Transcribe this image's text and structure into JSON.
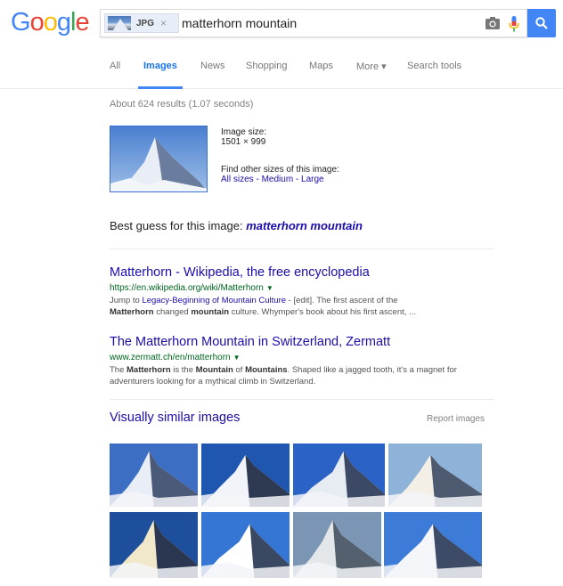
{
  "header": {
    "logo_letters": [
      "G",
      "o",
      "o",
      "g",
      "l",
      "e"
    ],
    "logo_colors": [
      "#4285f4",
      "#ea4335",
      "#fbbc05",
      "#4285f4",
      "#34a853",
      "#ea4335"
    ],
    "chip_label": "JPG",
    "chip_close": "×",
    "query": "matterhorn mountain"
  },
  "tabs": [
    {
      "label": "All",
      "active": false
    },
    {
      "label": "Images",
      "active": true
    },
    {
      "label": "News",
      "active": false
    },
    {
      "label": "Shopping",
      "active": false
    },
    {
      "label": "Maps",
      "active": false
    },
    {
      "label": "More ▾",
      "active": false
    },
    {
      "label": "Search tools",
      "active": false
    }
  ],
  "stats": "About 624 results (1.07 seconds)",
  "image_info": {
    "size_label": "Image size:",
    "size_value": "1501 × 999",
    "find_label": "Find other sizes of this image:",
    "sizes": [
      "All sizes",
      "Medium",
      "Large"
    ],
    "sep": " - "
  },
  "best_guess": {
    "label": "Best guess for this image: ",
    "value": "matterhorn mountain"
  },
  "results": [
    {
      "title": "Matterhorn - Wikipedia, the free encyclopedia",
      "url": "https://en.wikipedia.org/wiki/Matterhorn",
      "snippet_a": "Jump to ",
      "snippet_link": "Legacy-Beginning of Mountain Culture",
      "snippet_b": " - [edit]. The first ascent of the ",
      "snippet_bold1": "Matterhorn",
      "snippet_c": " changed ",
      "snippet_bold2": "mountain",
      "snippet_d": " culture. Whymper's book about his first ascent, ..."
    },
    {
      "title": "The Matterhorn Mountain in Switzerland, Zermatt",
      "url": "www.zermatt.ch/en/matterhorn",
      "snippet_a": "The ",
      "snippet_bold1": "Matterhorn",
      "snippet_b": " is the ",
      "snippet_bold2": "Mountain",
      "snippet_c": " of ",
      "snippet_bold3": "Mountains",
      "snippet_d": ". Shaped like a jagged tooth, it's a magnet for adventurers looking for a mythical climb in Switzerland."
    }
  ],
  "similar": {
    "title": "Visually similar images",
    "report": "Report images",
    "thumbs": [
      {
        "sky": "#3c6fc4",
        "peak": "#e9eef6",
        "shade": "#4a5a78"
      },
      {
        "sky": "#1f56b0",
        "peak": "#f1f4f8",
        "shade": "#2d3a52"
      },
      {
        "sky": "#2a62c6",
        "peak": "#e7ecf3",
        "shade": "#3c4964"
      },
      {
        "sky": "#8fb2d8",
        "peak": "#f3efe6",
        "shade": "#4e5a70"
      },
      {
        "sky": "#1e4f9c",
        "peak": "#f0e8c8",
        "shade": "#2b3650"
      },
      {
        "sky": "#3575d4",
        "peak": "#ffffff",
        "shade": "#3a4862"
      },
      {
        "sky": "#7b95b5",
        "peak": "#e4e7ea",
        "shade": "#55606e"
      },
      {
        "sky": "#3d7bd8",
        "peak": "#f4f6f9",
        "shade": "#3d4b66"
      }
    ]
  }
}
